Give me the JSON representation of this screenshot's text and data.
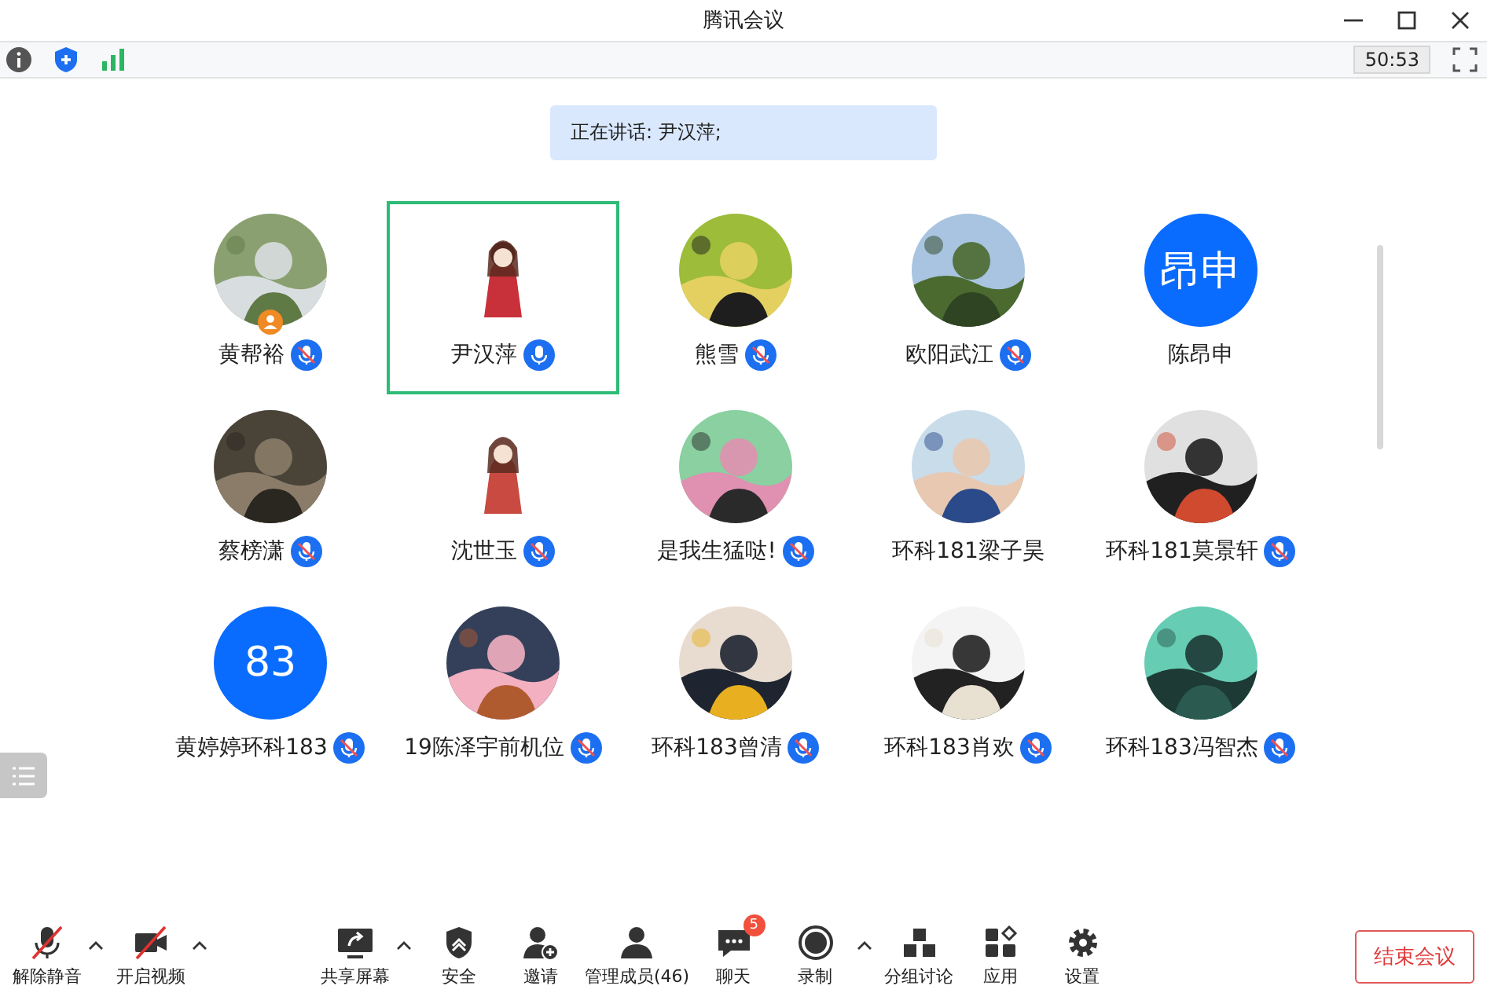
{
  "window": {
    "title": "腾讯会议"
  },
  "status": {
    "timer": "50:53"
  },
  "speaking": {
    "text": "正在讲话: 尹汉萍;"
  },
  "participants": [
    {
      "name": "黄帮裕",
      "mic": {
        "muted": true
      },
      "host": true,
      "selected": false
    },
    {
      "name": "尹汉萍",
      "avatar": {
        "kind": "sticker"
      },
      "mic": {
        "muted": false
      },
      "host": false,
      "selected": true
    },
    {
      "name": "熊雪",
      "mic": {
        "muted": true
      },
      "host": false,
      "selected": false
    },
    {
      "name": "欧阳武江",
      "mic": {
        "muted": true
      },
      "host": false,
      "selected": false
    },
    {
      "name": "陈昂申",
      "avatar": {
        "kind": "initials",
        "text": "昂申"
      },
      "host": false,
      "selected": false
    },
    {
      "name": "蔡榜潇",
      "mic": {
        "muted": true
      },
      "host": false,
      "selected": false
    },
    {
      "name": "沈世玉",
      "avatar": {
        "kind": "sticker"
      },
      "mic": {
        "muted": true
      },
      "host": false,
      "selected": false
    },
    {
      "name": "是我生猛哒!",
      "mic": {
        "muted": true
      },
      "host": false,
      "selected": false
    },
    {
      "name": "环科181梁子昊",
      "host": false,
      "selected": false
    },
    {
      "name": "环科181莫景轩",
      "mic": {
        "muted": true
      },
      "host": false,
      "selected": false
    },
    {
      "name": "黄婷婷环科183",
      "avatar": {
        "kind": "initials",
        "text": "83"
      },
      "mic": {
        "muted": true
      },
      "host": false,
      "selected": false
    },
    {
      "name": "19陈泽宇前机位",
      "mic": {
        "muted": true
      },
      "host": false,
      "selected": false
    },
    {
      "name": "环科183曾清",
      "mic": {
        "muted": true
      },
      "host": false,
      "selected": false
    },
    {
      "name": "环科183肖欢",
      "mic": {
        "muted": true
      },
      "host": false,
      "selected": false
    },
    {
      "name": "环科183冯智杰",
      "mic": {
        "muted": true
      },
      "host": false,
      "selected": false
    }
  ],
  "toolbar": [
    {
      "label": "解除静音",
      "kind": "mic",
      "off": true,
      "menu": true
    },
    {
      "label": "开启视频",
      "kind": "video",
      "off": true,
      "menu": true
    },
    {
      "label": "共享屏幕",
      "kind": "share",
      "off": false,
      "menu": true
    },
    {
      "label": "安全",
      "kind": "security",
      "off": false,
      "menu": false
    },
    {
      "label": "邀请",
      "kind": "invite",
      "off": false,
      "menu": false
    },
    {
      "label": "管理成员(46)",
      "kind": "members",
      "off": false,
      "menu": false
    },
    {
      "label": "聊天",
      "kind": "chat",
      "off": false,
      "menu": false,
      "badge": "5"
    },
    {
      "label": "录制",
      "kind": "record",
      "off": false,
      "menu": true
    },
    {
      "label": "分组讨论",
      "kind": "groups",
      "off": false,
      "menu": false
    },
    {
      "label": "应用",
      "kind": "apps",
      "off": false,
      "menu": false
    },
    {
      "label": "设置",
      "kind": "settings",
      "off": false,
      "menu": false
    }
  ],
  "end_button": {
    "label": "结束会议"
  }
}
